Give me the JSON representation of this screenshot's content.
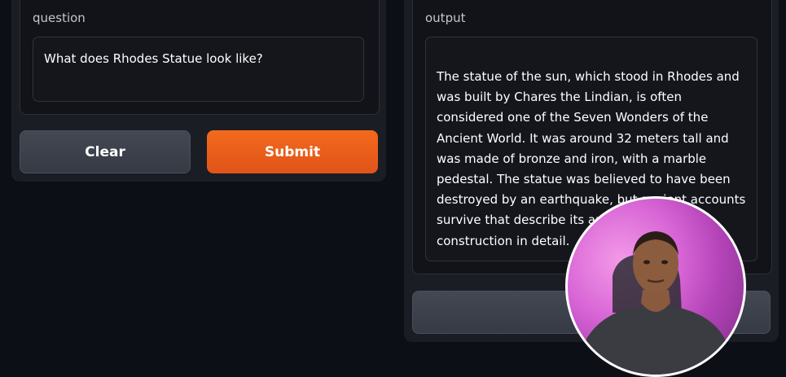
{
  "question": {
    "label": "question",
    "value": "What does Rhodes Statue look like?"
  },
  "buttons": {
    "clear_label": "Clear",
    "submit_label": "Submit"
  },
  "output": {
    "label": "output",
    "text": "The statue of the sun, which stood in Rhodes and was built by Chares the Lindian, is often considered one of the Seven Wonders of the Ancient World. It was around 32 meters tall and was made of bronze and iron, with a marble pedestal. The statue was believed to have been destroyed by an earthquake, but ancient accounts survive that describe its appearance and construction in detail."
  },
  "colors": {
    "background": "#0c0f15",
    "panel": "#1b1d24",
    "submit_accent": "#f26a1c",
    "secondary_button": "#3d414b"
  }
}
